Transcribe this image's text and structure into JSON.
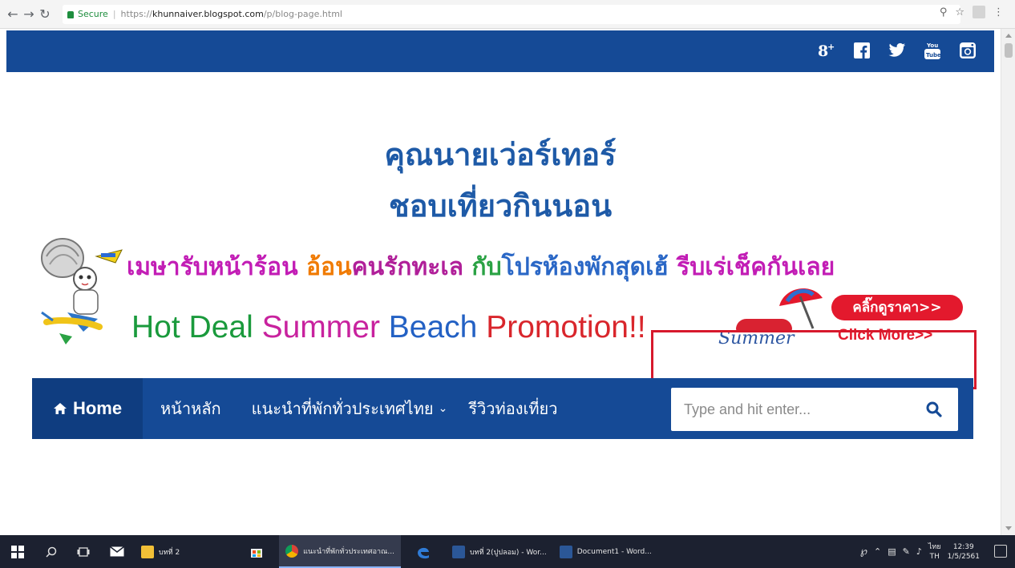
{
  "browser": {
    "secure_label": "Secure",
    "url_protocol": "https://",
    "url_host": "khunnaiver.blogspot.com",
    "url_path": "/p/blog-page.html"
  },
  "blog": {
    "title": "คุณนายเว่อร์เทอร์",
    "subtitle": "ชอบเที่ยวกินนอน"
  },
  "banner": {
    "th_part1": "เมษารับหน้าร้อน ",
    "th_part2": "อ้อน",
    "th_part3": "คนรักทะเล ",
    "th_part4": "กับ",
    "th_part5": "โปรห้องพักสุดเฮ้ ",
    "th_part6": "รีบเร่เช็คกันเลย",
    "en_part1": "Hot Deal ",
    "en_part2": "Summer ",
    "en_part3": "Beach ",
    "en_part4": "Promotion!!",
    "price_button": "คลิ๊กดูราคา>>",
    "summer_script": "Summer",
    "click_more": "Click More>>"
  },
  "nav": {
    "home": "Home",
    "main_page": "หน้าหลัก",
    "recommend": "แนะนำที่พักทั่วประเทศไทย",
    "review": "รีวิวท่องเที่ยว"
  },
  "search": {
    "placeholder": "Type and hit enter..."
  },
  "taskbar": {
    "folder_label": "บทที่ 2",
    "chrome_label": "แนะนำที่พักทั่วประเทศอาณ...",
    "word1_label": "บทที่ 2(ปูปลอม) - Wor...",
    "word2_label": "Document1 - Word...",
    "lang_top": "ไทย",
    "lang_bottom": "TH",
    "time": "12:39",
    "date": "1/5/2561"
  },
  "colors": {
    "nav_blue": "#154a96",
    "home_blue": "#0f3d80",
    "title_blue": "#1e5aa7",
    "accent_red": "#e3192d"
  },
  "icons": [
    "google-plus-icon",
    "facebook-icon",
    "twitter-icon",
    "youtube-icon",
    "instagram-icon",
    "home-icon",
    "search-icon",
    "chevron-down-icon"
  ]
}
